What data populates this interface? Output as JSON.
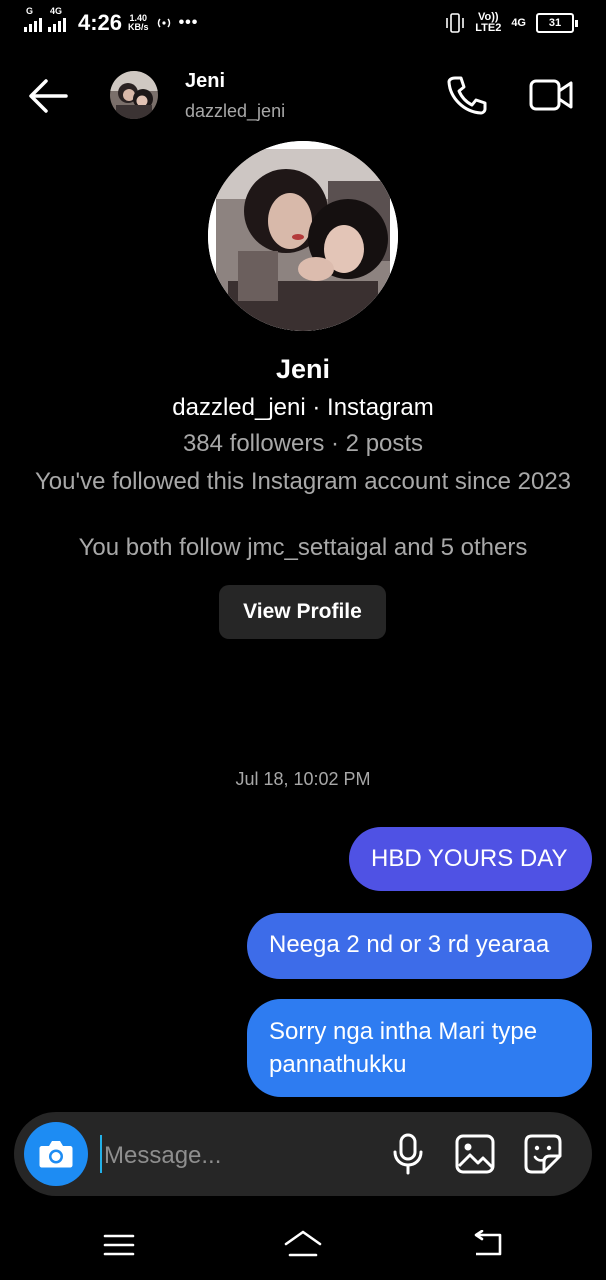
{
  "status_bar": {
    "sim1_tag": "G",
    "sim2_tag": "4G",
    "time": "4:26",
    "speed_value": "1.40",
    "speed_unit": "KB/s",
    "volte_label": "Vo))",
    "lte_label": "LTE2",
    "net_label": "4G",
    "battery": "31"
  },
  "header": {
    "name": "Jeni",
    "username": "dazzled_jeni"
  },
  "profile": {
    "name": "Jeni",
    "handle": "dazzled_jeni · Instagram",
    "stats": "384 followers · 2 posts",
    "follow_since": "You've followed this Instagram account since 2023",
    "mutual": "You both follow jmc_settaigal and 5 others",
    "view_profile_label": "View Profile"
  },
  "conversation": {
    "timestamp": "Jul 18, 10:02 PM",
    "messages": [
      {
        "text": "HBD YOURS DAY",
        "color": "#4f52e4"
      },
      {
        "text": "Neega 2 nd or 3 rd yearaa",
        "color": "#3d6ce9"
      },
      {
        "text": "Sorry nga intha Mari type pannathukku",
        "color": "#2e7cf1"
      }
    ]
  },
  "composer": {
    "placeholder": "Message...",
    "camera_icon": "camera-icon",
    "mic_icon": "microphone-icon",
    "gallery_icon": "gallery-icon",
    "sticker_icon": "sticker-icon"
  },
  "colors": {
    "background": "#000000",
    "secondary_text": "#a8a8a8",
    "camera_button": "#1d8cf3",
    "composer_bg": "#262626"
  }
}
